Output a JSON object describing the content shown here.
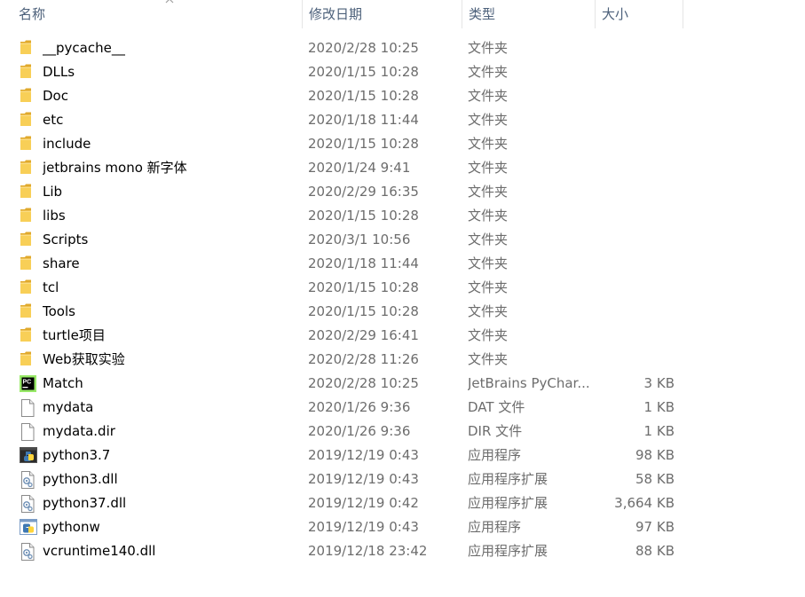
{
  "columns": {
    "name": "名称",
    "date": "修改日期",
    "type": "类型",
    "size": "大小"
  },
  "colors": {
    "folder": "#f4c542",
    "folder_dark": "#e0a92c",
    "header_text": "#4c607a",
    "meta_text": "#6d6d6d"
  },
  "files": [
    {
      "name": "__pycache__",
      "date": "2020/2/28 10:25",
      "type": "文件夹",
      "size": "",
      "icon": "folder-icon"
    },
    {
      "name": "DLLs",
      "date": "2020/1/15 10:28",
      "type": "文件夹",
      "size": "",
      "icon": "folder-icon"
    },
    {
      "name": "Doc",
      "date": "2020/1/15 10:28",
      "type": "文件夹",
      "size": "",
      "icon": "folder-icon"
    },
    {
      "name": "etc",
      "date": "2020/1/18 11:44",
      "type": "文件夹",
      "size": "",
      "icon": "folder-icon"
    },
    {
      "name": "include",
      "date": "2020/1/15 10:28",
      "type": "文件夹",
      "size": "",
      "icon": "folder-icon"
    },
    {
      "name": "jetbrains mono 新字体",
      "date": "2020/1/24 9:41",
      "type": "文件夹",
      "size": "",
      "icon": "folder-icon"
    },
    {
      "name": "Lib",
      "date": "2020/2/29 16:35",
      "type": "文件夹",
      "size": "",
      "icon": "folder-icon"
    },
    {
      "name": "libs",
      "date": "2020/1/15 10:28",
      "type": "文件夹",
      "size": "",
      "icon": "folder-icon"
    },
    {
      "name": "Scripts",
      "date": "2020/3/1 10:56",
      "type": "文件夹",
      "size": "",
      "icon": "folder-icon"
    },
    {
      "name": "share",
      "date": "2020/1/18 11:44",
      "type": "文件夹",
      "size": "",
      "icon": "folder-icon"
    },
    {
      "name": "tcl",
      "date": "2020/1/15 10:28",
      "type": "文件夹",
      "size": "",
      "icon": "folder-icon"
    },
    {
      "name": "Tools",
      "date": "2020/1/15 10:28",
      "type": "文件夹",
      "size": "",
      "icon": "folder-icon"
    },
    {
      "name": "turtle项目",
      "date": "2020/2/29 16:41",
      "type": "文件夹",
      "size": "",
      "icon": "folder-icon"
    },
    {
      "name": "Web获取实验",
      "date": "2020/2/28 11:26",
      "type": "文件夹",
      "size": "",
      "icon": "folder-icon"
    },
    {
      "name": "Match",
      "date": "2020/2/28 10:25",
      "type": "JetBrains PyChar...",
      "size": "3 KB",
      "icon": "pycharm-icon"
    },
    {
      "name": "mydata",
      "date": "2020/1/26 9:36",
      "type": "DAT 文件",
      "size": "1 KB",
      "icon": "file-icon"
    },
    {
      "name": "mydata.dir",
      "date": "2020/1/26 9:36",
      "type": "DIR 文件",
      "size": "1 KB",
      "icon": "file-icon"
    },
    {
      "name": "python3.7",
      "date": "2019/12/19 0:43",
      "type": "应用程序",
      "size": "98 KB",
      "icon": "python-app-icon"
    },
    {
      "name": "python3.dll",
      "date": "2019/12/19 0:43",
      "type": "应用程序扩展",
      "size": "58 KB",
      "icon": "dll-icon"
    },
    {
      "name": "python37.dll",
      "date": "2019/12/19 0:42",
      "type": "应用程序扩展",
      "size": "3,664 KB",
      "icon": "dll-icon"
    },
    {
      "name": "pythonw",
      "date": "2019/12/19 0:43",
      "type": "应用程序",
      "size": "97 KB",
      "icon": "python-window-icon"
    },
    {
      "name": "vcruntime140.dll",
      "date": "2019/12/18 23:42",
      "type": "应用程序扩展",
      "size": "88 KB",
      "icon": "dll-icon"
    }
  ]
}
